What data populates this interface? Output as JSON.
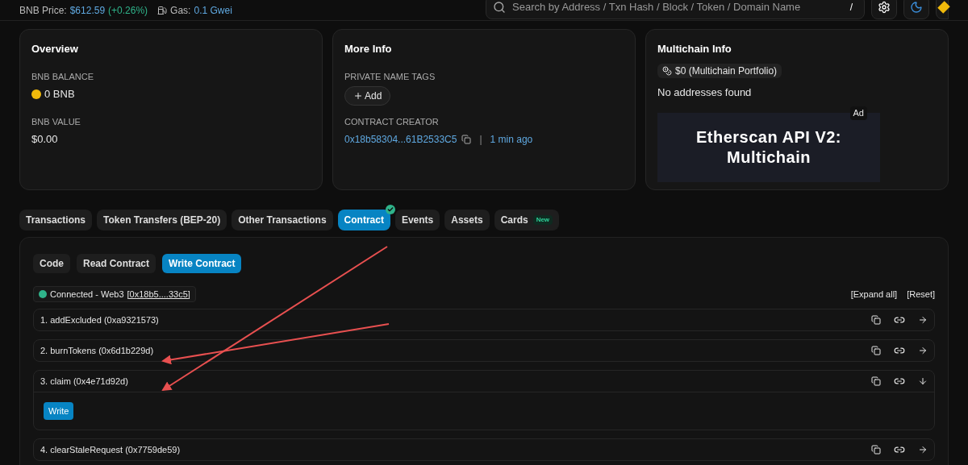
{
  "top_bar": {
    "price_label": "BNB Price:",
    "price": "$612.59",
    "price_change": "(+0.26%)",
    "gas_label": "Gas:",
    "gas": "0.1 Gwei",
    "search": {
      "placeholder": "Search by Address / Txn Hash / Block / Token / Domain Name",
      "shortcut": "/"
    }
  },
  "overview": {
    "title": "Overview",
    "balance_label": "BNB BALANCE",
    "balance": "0 BNB",
    "value_label": "BNB VALUE",
    "value": "$0.00"
  },
  "more_info": {
    "title": "More Info",
    "tags_label": "PRIVATE NAME TAGS",
    "add_button": "Add",
    "creator_label": "CONTRACT CREATOR",
    "creator_address": "0x18b58304...61B2533C5",
    "separator": "|",
    "creator_time": "1 min ago"
  },
  "multichain": {
    "title": "Multichain Info",
    "portfolio": "$0 (Multichain Portfolio)",
    "empty": "No addresses found",
    "ad_label": "Ad",
    "ad_text": "Etherscan API V2: Multichain"
  },
  "tabs": [
    {
      "label": "Transactions",
      "selected": false,
      "verified": false
    },
    {
      "label": "Token Transfers (BEP-20)",
      "selected": false,
      "verified": false
    },
    {
      "label": "Other Transactions",
      "selected": false,
      "verified": false
    },
    {
      "label": "Contract",
      "selected": true,
      "verified": true
    },
    {
      "label": "Events",
      "selected": false,
      "verified": false
    },
    {
      "label": "Assets",
      "selected": false,
      "verified": false
    },
    {
      "label": "Cards",
      "selected": false,
      "verified": false,
      "badge": "New"
    }
  ],
  "sub_tabs": [
    {
      "label": "Code",
      "selected": false
    },
    {
      "label": "Read Contract",
      "selected": false
    },
    {
      "label": "Write Contract",
      "selected": true
    }
  ],
  "connection": {
    "connected": true,
    "label": "Connected - Web3",
    "address": "[0x18b5....33c5]",
    "expand_all": "[Expand all]",
    "reset": "[Reset]"
  },
  "functions": [
    {
      "label": "1. addExcluded (0xa9321573)",
      "expanded": false
    },
    {
      "label": "2. burnTokens (0x6d1b229d)",
      "expanded": false
    },
    {
      "label": "3. claim (0x4e71d92d)",
      "expanded": true,
      "button": "Write"
    },
    {
      "label": "4. clearStaleRequest (0x7759de59)",
      "expanded": false
    }
  ]
}
